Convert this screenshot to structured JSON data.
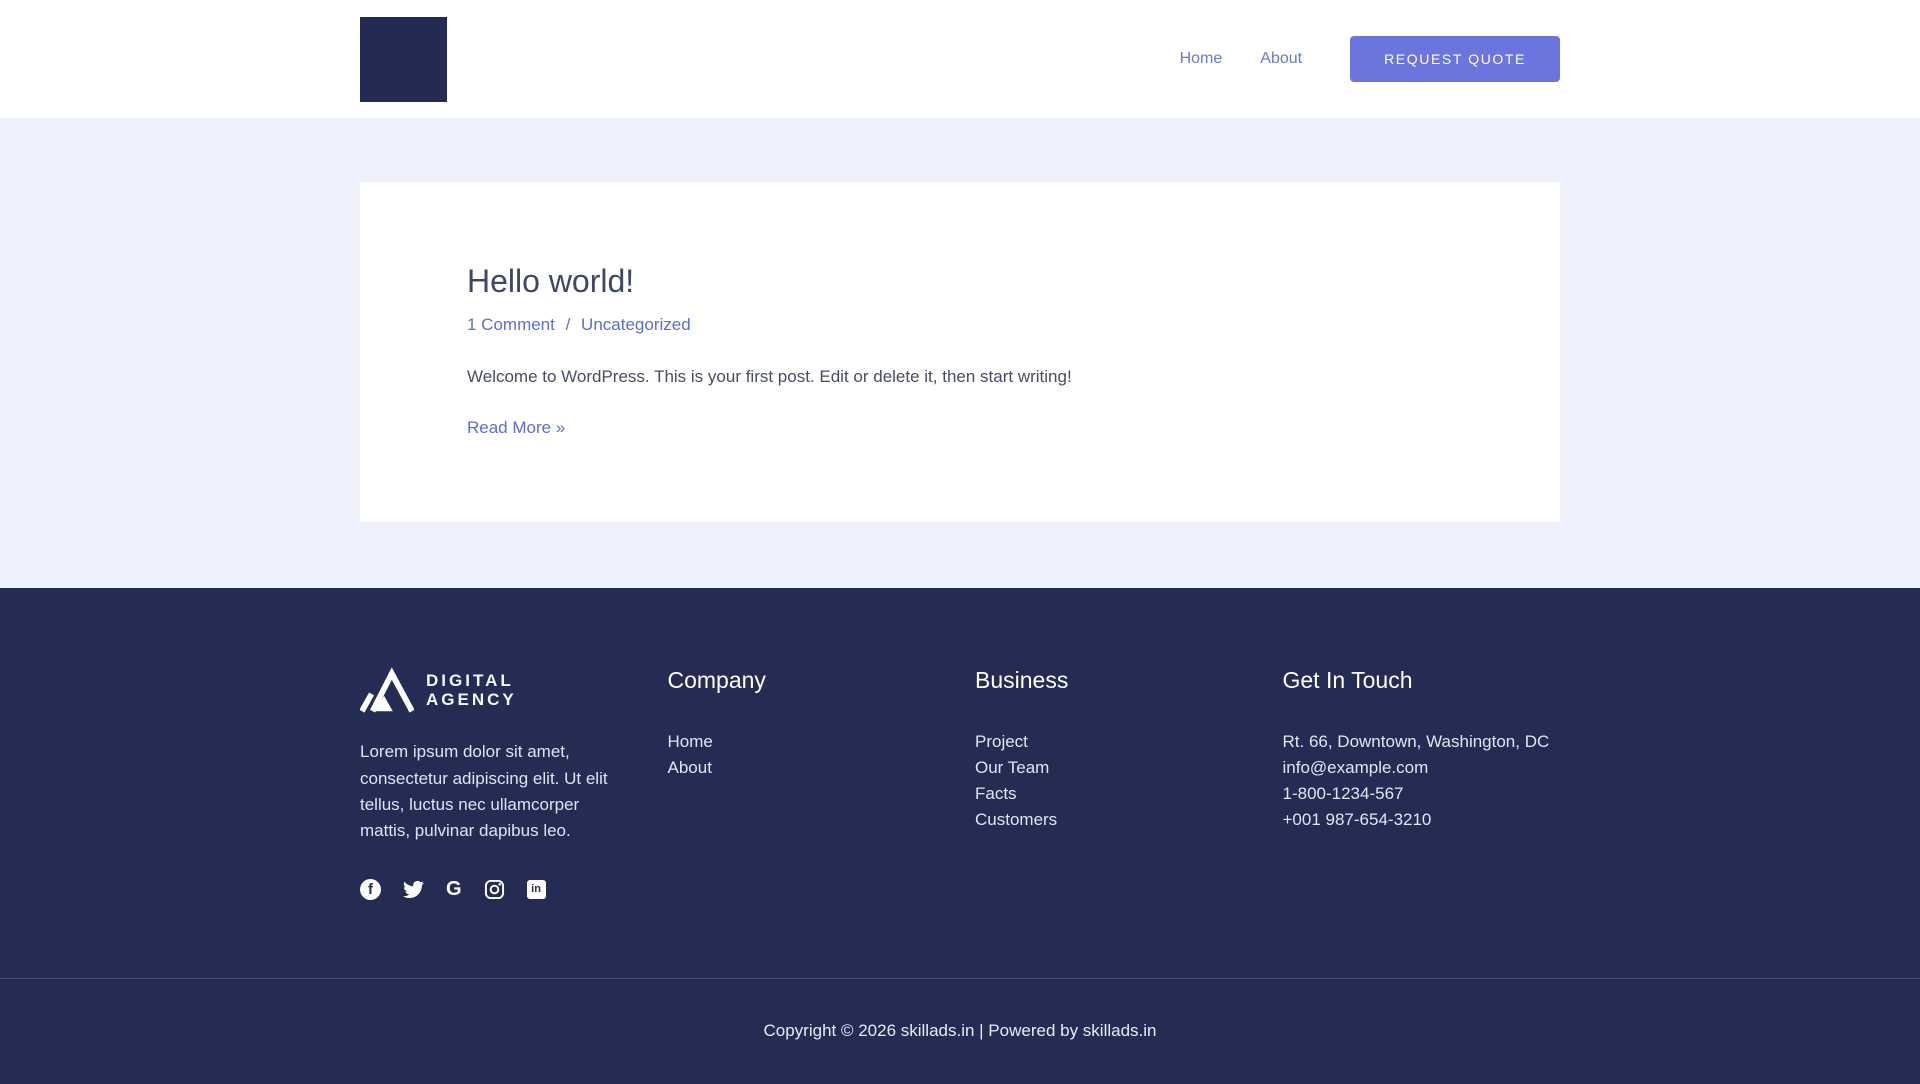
{
  "header": {
    "nav": [
      {
        "label": "Home"
      },
      {
        "label": "About"
      }
    ],
    "button_label": "REQUEST QUOTE"
  },
  "post": {
    "title": "Hello world!",
    "meta": {
      "comments": "1 Comment",
      "separator": "/",
      "category": "Uncategorized"
    },
    "excerpt": "Welcome to WordPress. This is your first post. Edit or delete it, then start writing!",
    "read_more": "Read More »"
  },
  "footer": {
    "brand": {
      "line1": "DIGITAL",
      "line2": "AGENCY"
    },
    "description": "Lorem ipsum dolor sit amet, consectetur adipiscing elit. Ut elit tellus, luctus nec ullamcorper mattis, pulvinar dapibus leo.",
    "social_glyphs": {
      "facebook": "f",
      "google": "G",
      "linkedin": "in"
    },
    "columns": [
      {
        "title": "Company",
        "items": [
          "Home",
          "About"
        ]
      },
      {
        "title": "Business",
        "items": [
          "Project",
          "Our Team",
          "Facts",
          "Customers"
        ]
      },
      {
        "title": "Get In Touch",
        "items": [
          "Rt. 66, Downtown, Washington, DC",
          "info@example.com",
          "1-800-1234-567",
          "+001 987-654-3210"
        ]
      }
    ],
    "copyright": "Copyright © 2026 skillads.in | Powered by skillads.in"
  },
  "colors": {
    "accent_link": "#6977DA",
    "button_bg": "#6B75DD",
    "navy": "#242C54",
    "logo_square": "#232B52",
    "page_background": "#EEF1FB",
    "heading": "#3E4767"
  }
}
